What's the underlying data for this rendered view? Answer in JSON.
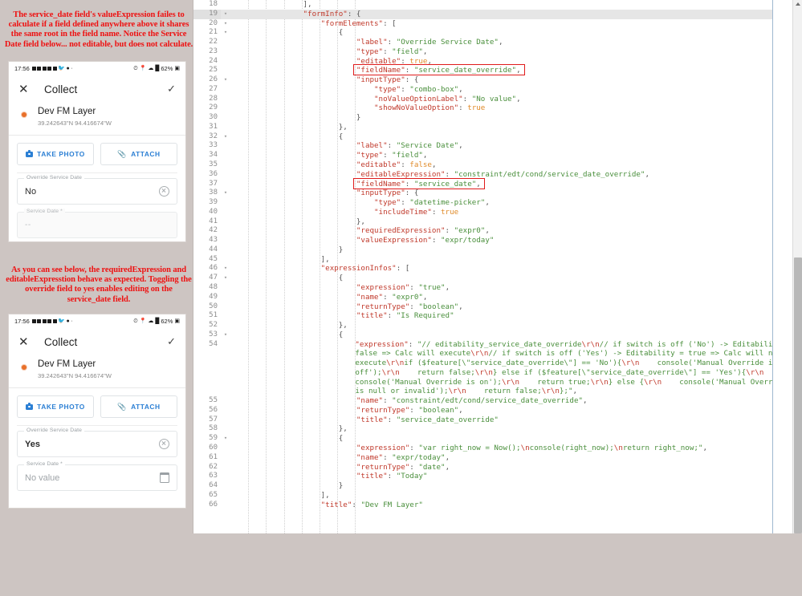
{
  "annotations": {
    "top": "The service_date field's valueExpression failes to calculate if a field defined anywhere above it shares the same root in the field name.  Notice the Service Date field below... not editable, but does not calculate.",
    "middle": "As you can see below, the requiredExpression and editableExpresstion behave as expected. Toggling the override field to yes enables editing on the service_date field."
  },
  "phones": [
    {
      "status": {
        "time": "17:56",
        "battery": "62%"
      },
      "app_bar": {
        "close": "✕",
        "title": "Collect",
        "confirm": "✓"
      },
      "layer": {
        "name": "Dev FM Layer",
        "coords": "39.242643\"N  94.416674\"W"
      },
      "actions": [
        {
          "label": "TAKE PHOTO",
          "icon": "camera-icon"
        },
        {
          "label": "ATTACH",
          "icon": "paperclip-icon"
        }
      ],
      "fields": [
        {
          "label": "Override Service Date",
          "value": "No",
          "trailing_icon": "clear-icon",
          "disabled": false,
          "bold": false
        },
        {
          "label": "Service Date *",
          "value": "--",
          "trailing_icon": "none",
          "disabled": true,
          "bold": false
        }
      ]
    },
    {
      "status": {
        "time": "17:56",
        "battery": "62%"
      },
      "app_bar": {
        "close": "✕",
        "title": "Collect",
        "confirm": "✓"
      },
      "layer": {
        "name": "Dev FM Layer",
        "coords": "39.242643\"N  94.416674\"W"
      },
      "actions": [
        {
          "label": "TAKE PHOTO",
          "icon": "camera-icon"
        },
        {
          "label": "ATTACH",
          "icon": "paperclip-icon"
        }
      ],
      "fields": [
        {
          "label": "Override Service Date",
          "value": "Yes",
          "trailing_icon": "clear-icon",
          "disabled": false,
          "bold": true
        },
        {
          "label": "Service Date *",
          "value": "No value",
          "trailing_icon": "calendar-icon",
          "disabled": false,
          "bold": false
        }
      ]
    }
  ],
  "editor": {
    "active_line": 19,
    "first_line": 18,
    "last_line": 66,
    "colors": {
      "key": "#c0392b",
      "string": "#4a8f3c",
      "boolean": "#e08b2a",
      "highlight_box": "#e01b1b",
      "active_line_bg": "#e6e6e6"
    },
    "lines": [
      {
        "n": 18,
        "indent": 4,
        "tokens": [
          {
            "t": "p",
            "v": "],"
          }
        ]
      },
      {
        "n": 19,
        "indent": 4,
        "fold": true,
        "active": true,
        "tokens": [
          {
            "t": "k",
            "v": "\"formInfo\""
          },
          {
            "t": "p",
            "v": ": {"
          }
        ]
      },
      {
        "n": 20,
        "indent": 5,
        "fold": true,
        "tokens": [
          {
            "t": "k",
            "v": "\"formElements\""
          },
          {
            "t": "p",
            "v": ": ["
          }
        ]
      },
      {
        "n": 21,
        "indent": 6,
        "fold": true,
        "tokens": [
          {
            "t": "p",
            "v": "{"
          }
        ]
      },
      {
        "n": 22,
        "indent": 7,
        "tokens": [
          {
            "t": "k",
            "v": "\"label\""
          },
          {
            "t": "p",
            "v": ": "
          },
          {
            "t": "s",
            "v": "\"Override Service Date\""
          },
          {
            "t": "p",
            "v": ","
          }
        ]
      },
      {
        "n": 23,
        "indent": 7,
        "tokens": [
          {
            "t": "k",
            "v": "\"type\""
          },
          {
            "t": "p",
            "v": ": "
          },
          {
            "t": "s",
            "v": "\"field\""
          },
          {
            "t": "p",
            "v": ","
          }
        ]
      },
      {
        "n": 24,
        "indent": 7,
        "tokens": [
          {
            "t": "k",
            "v": "\"editable\""
          },
          {
            "t": "p",
            "v": ": "
          },
          {
            "t": "b",
            "v": "true"
          },
          {
            "t": "p",
            "v": ","
          }
        ]
      },
      {
        "n": 25,
        "indent": 7,
        "boxed": true,
        "tokens": [
          {
            "t": "k",
            "v": "\"fieldName\""
          },
          {
            "t": "p",
            "v": ": "
          },
          {
            "t": "s",
            "v": "\"service_date_override\""
          },
          {
            "t": "p",
            "v": ","
          }
        ]
      },
      {
        "n": 26,
        "indent": 7,
        "fold": true,
        "tokens": [
          {
            "t": "k",
            "v": "\"inputType\""
          },
          {
            "t": "p",
            "v": ": {"
          }
        ]
      },
      {
        "n": 27,
        "indent": 8,
        "tokens": [
          {
            "t": "k",
            "v": "\"type\""
          },
          {
            "t": "p",
            "v": ": "
          },
          {
            "t": "s",
            "v": "\"combo-box\""
          },
          {
            "t": "p",
            "v": ","
          }
        ]
      },
      {
        "n": 28,
        "indent": 8,
        "tokens": [
          {
            "t": "k",
            "v": "\"noValueOptionLabel\""
          },
          {
            "t": "p",
            "v": ": "
          },
          {
            "t": "s",
            "v": "\"No value\""
          },
          {
            "t": "p",
            "v": ","
          }
        ]
      },
      {
        "n": 29,
        "indent": 8,
        "tokens": [
          {
            "t": "k",
            "v": "\"showNoValueOption\""
          },
          {
            "t": "p",
            "v": ": "
          },
          {
            "t": "b",
            "v": "true"
          }
        ]
      },
      {
        "n": 30,
        "indent": 7,
        "tokens": [
          {
            "t": "p",
            "v": "}"
          }
        ]
      },
      {
        "n": 31,
        "indent": 6,
        "tokens": [
          {
            "t": "p",
            "v": "},"
          }
        ]
      },
      {
        "n": 32,
        "indent": 6,
        "fold": true,
        "tokens": [
          {
            "t": "p",
            "v": "{"
          }
        ]
      },
      {
        "n": 33,
        "indent": 7,
        "tokens": [
          {
            "t": "k",
            "v": "\"label\""
          },
          {
            "t": "p",
            "v": ": "
          },
          {
            "t": "s",
            "v": "\"Service Date\""
          },
          {
            "t": "p",
            "v": ","
          }
        ]
      },
      {
        "n": 34,
        "indent": 7,
        "tokens": [
          {
            "t": "k",
            "v": "\"type\""
          },
          {
            "t": "p",
            "v": ": "
          },
          {
            "t": "s",
            "v": "\"field\""
          },
          {
            "t": "p",
            "v": ","
          }
        ]
      },
      {
        "n": 35,
        "indent": 7,
        "tokens": [
          {
            "t": "k",
            "v": "\"editable\""
          },
          {
            "t": "p",
            "v": ": "
          },
          {
            "t": "b",
            "v": "false"
          },
          {
            "t": "p",
            "v": ","
          }
        ]
      },
      {
        "n": 36,
        "indent": 7,
        "tokens": [
          {
            "t": "k",
            "v": "\"editableExpression\""
          },
          {
            "t": "p",
            "v": ": "
          },
          {
            "t": "s",
            "v": "\"constraint/edt/cond/service_date_override\""
          },
          {
            "t": "p",
            "v": ","
          }
        ]
      },
      {
        "n": 37,
        "indent": 7,
        "boxed": true,
        "tokens": [
          {
            "t": "k",
            "v": "\"fieldName\""
          },
          {
            "t": "p",
            "v": ": "
          },
          {
            "t": "s",
            "v": "\"service_date\""
          },
          {
            "t": "p",
            "v": ","
          }
        ]
      },
      {
        "n": 38,
        "indent": 7,
        "fold": true,
        "tokens": [
          {
            "t": "k",
            "v": "\"inputType\""
          },
          {
            "t": "p",
            "v": ": {"
          }
        ]
      },
      {
        "n": 39,
        "indent": 8,
        "tokens": [
          {
            "t": "k",
            "v": "\"type\""
          },
          {
            "t": "p",
            "v": ": "
          },
          {
            "t": "s",
            "v": "\"datetime-picker\""
          },
          {
            "t": "p",
            "v": ","
          }
        ]
      },
      {
        "n": 40,
        "indent": 8,
        "tokens": [
          {
            "t": "k",
            "v": "\"includeTime\""
          },
          {
            "t": "p",
            "v": ": "
          },
          {
            "t": "b",
            "v": "true"
          }
        ]
      },
      {
        "n": 41,
        "indent": 7,
        "tokens": [
          {
            "t": "p",
            "v": "},"
          }
        ]
      },
      {
        "n": 42,
        "indent": 7,
        "tokens": [
          {
            "t": "k",
            "v": "\"requiredExpression\""
          },
          {
            "t": "p",
            "v": ": "
          },
          {
            "t": "s",
            "v": "\"expr0\""
          },
          {
            "t": "p",
            "v": ","
          }
        ]
      },
      {
        "n": 43,
        "indent": 7,
        "tokens": [
          {
            "t": "k",
            "v": "\"valueExpression\""
          },
          {
            "t": "p",
            "v": ": "
          },
          {
            "t": "s",
            "v": "\"expr/today\""
          }
        ]
      },
      {
        "n": 44,
        "indent": 6,
        "tokens": [
          {
            "t": "p",
            "v": "}"
          }
        ]
      },
      {
        "n": 45,
        "indent": 5,
        "tokens": [
          {
            "t": "p",
            "v": "],"
          }
        ]
      },
      {
        "n": 46,
        "indent": 5,
        "fold": true,
        "tokens": [
          {
            "t": "k",
            "v": "\"expressionInfos\""
          },
          {
            "t": "p",
            "v": ": ["
          }
        ]
      },
      {
        "n": 47,
        "indent": 6,
        "fold": true,
        "tokens": [
          {
            "t": "p",
            "v": "{"
          }
        ]
      },
      {
        "n": 48,
        "indent": 7,
        "tokens": [
          {
            "t": "k",
            "v": "\"expression\""
          },
          {
            "t": "p",
            "v": ": "
          },
          {
            "t": "s",
            "v": "\"true\""
          },
          {
            "t": "p",
            "v": ","
          }
        ]
      },
      {
        "n": 49,
        "indent": 7,
        "tokens": [
          {
            "t": "k",
            "v": "\"name\""
          },
          {
            "t": "p",
            "v": ": "
          },
          {
            "t": "s",
            "v": "\"expr0\""
          },
          {
            "t": "p",
            "v": ","
          }
        ]
      },
      {
        "n": 50,
        "indent": 7,
        "tokens": [
          {
            "t": "k",
            "v": "\"returnType\""
          },
          {
            "t": "p",
            "v": ": "
          },
          {
            "t": "s",
            "v": "\"boolean\""
          },
          {
            "t": "p",
            "v": ","
          }
        ]
      },
      {
        "n": 51,
        "indent": 7,
        "tokens": [
          {
            "t": "k",
            "v": "\"title\""
          },
          {
            "t": "p",
            "v": ": "
          },
          {
            "t": "s",
            "v": "\"Is Required\""
          }
        ]
      },
      {
        "n": 52,
        "indent": 6,
        "tokens": [
          {
            "t": "p",
            "v": "},"
          }
        ]
      },
      {
        "n": 53,
        "indent": 6,
        "fold": true,
        "tokens": [
          {
            "t": "p",
            "v": "{"
          }
        ]
      },
      {
        "n": 54,
        "indent": 7,
        "wrapped": true,
        "tokens": [
          {
            "t": "k",
            "v": "\"expression\""
          },
          {
            "t": "p",
            "v": ": "
          },
          {
            "t": "s",
            "v": "\"// editability_service_date_override"
          },
          {
            "t": "esc",
            "v": "\\r\\n"
          },
          {
            "t": "s",
            "v": "// if switch is off ('No') -> Editability = false => Calc will execute"
          },
          {
            "t": "esc",
            "v": "\\r\\n"
          },
          {
            "t": "s",
            "v": "// if switch is off ('Yes') -> Editability = true => Calc will not execute"
          },
          {
            "t": "esc",
            "v": "\\r\\n"
          },
          {
            "t": "s",
            "v": "if ($feature[\\\"service_date_override\\\"] == 'No'){"
          },
          {
            "t": "esc",
            "v": "\\r\\n"
          },
          {
            "t": "s",
            "v": "    console('Manual Override is off');"
          },
          {
            "t": "esc",
            "v": "\\r\\n"
          },
          {
            "t": "s",
            "v": "    return false;"
          },
          {
            "t": "esc",
            "v": "\\r\\n"
          },
          {
            "t": "s",
            "v": "} else if ($feature[\\\"service_date_override\\\"] == 'Yes'){"
          },
          {
            "t": "esc",
            "v": "\\r\\n"
          },
          {
            "t": "s",
            "v": "    console('Manual Override is on');"
          },
          {
            "t": "esc",
            "v": "\\r\\n"
          },
          {
            "t": "s",
            "v": "    return true;"
          },
          {
            "t": "esc",
            "v": "\\r\\n"
          },
          {
            "t": "s",
            "v": "} else {"
          },
          {
            "t": "esc",
            "v": "\\r\\n"
          },
          {
            "t": "s",
            "v": "    console('Manual Override is null or invalid');"
          },
          {
            "t": "esc",
            "v": "\\r\\n"
          },
          {
            "t": "s",
            "v": "    return false;"
          },
          {
            "t": "esc",
            "v": "\\r\\n"
          },
          {
            "t": "s",
            "v": "};\""
          },
          {
            "t": "p",
            "v": ","
          }
        ]
      },
      {
        "n": 55,
        "indent": 7,
        "tokens": [
          {
            "t": "k",
            "v": "\"name\""
          },
          {
            "t": "p",
            "v": ": "
          },
          {
            "t": "s",
            "v": "\"constraint/edt/cond/service_date_override\""
          },
          {
            "t": "p",
            "v": ","
          }
        ]
      },
      {
        "n": 56,
        "indent": 7,
        "tokens": [
          {
            "t": "k",
            "v": "\"returnType\""
          },
          {
            "t": "p",
            "v": ": "
          },
          {
            "t": "s",
            "v": "\"boolean\""
          },
          {
            "t": "p",
            "v": ","
          }
        ]
      },
      {
        "n": 57,
        "indent": 7,
        "tokens": [
          {
            "t": "k",
            "v": "\"title\""
          },
          {
            "t": "p",
            "v": ": "
          },
          {
            "t": "s",
            "v": "\"service_date_override\""
          }
        ]
      },
      {
        "n": 58,
        "indent": 6,
        "tokens": [
          {
            "t": "p",
            "v": "},"
          }
        ]
      },
      {
        "n": 59,
        "indent": 6,
        "fold": true,
        "tokens": [
          {
            "t": "p",
            "v": "{"
          }
        ]
      },
      {
        "n": 60,
        "indent": 7,
        "tokens": [
          {
            "t": "k",
            "v": "\"expression\""
          },
          {
            "t": "p",
            "v": ": "
          },
          {
            "t": "s",
            "v": "\"var right_now = Now();"
          },
          {
            "t": "esc",
            "v": "\\n"
          },
          {
            "t": "s",
            "v": "console(right_now);"
          },
          {
            "t": "esc",
            "v": "\\n"
          },
          {
            "t": "s",
            "v": "return right_now;\""
          },
          {
            "t": "p",
            "v": ","
          }
        ]
      },
      {
        "n": 61,
        "indent": 7,
        "tokens": [
          {
            "t": "k",
            "v": "\"name\""
          },
          {
            "t": "p",
            "v": ": "
          },
          {
            "t": "s",
            "v": "\"expr/today\""
          },
          {
            "t": "p",
            "v": ","
          }
        ]
      },
      {
        "n": 62,
        "indent": 7,
        "tokens": [
          {
            "t": "k",
            "v": "\"returnType\""
          },
          {
            "t": "p",
            "v": ": "
          },
          {
            "t": "s",
            "v": "\"date\""
          },
          {
            "t": "p",
            "v": ","
          }
        ]
      },
      {
        "n": 63,
        "indent": 7,
        "tokens": [
          {
            "t": "k",
            "v": "\"title\""
          },
          {
            "t": "p",
            "v": ": "
          },
          {
            "t": "s",
            "v": "\"Today\""
          }
        ]
      },
      {
        "n": 64,
        "indent": 6,
        "tokens": [
          {
            "t": "p",
            "v": "}"
          }
        ]
      },
      {
        "n": 65,
        "indent": 5,
        "tokens": [
          {
            "t": "p",
            "v": "],"
          }
        ]
      },
      {
        "n": 66,
        "indent": 5,
        "tokens": [
          {
            "t": "k",
            "v": "\"title\""
          },
          {
            "t": "p",
            "v": ": "
          },
          {
            "t": "s",
            "v": "\"Dev FM Layer\""
          }
        ]
      }
    ]
  }
}
